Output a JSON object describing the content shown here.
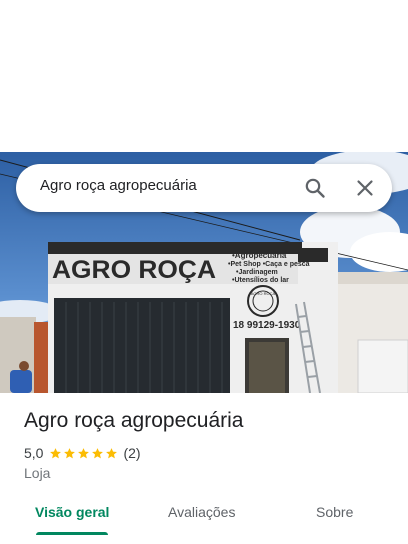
{
  "search": {
    "query": "Agro roça agropecuária"
  },
  "photo": {
    "sign_text": "AGRO ROÇA",
    "sign_services": [
      "•Agropecuária",
      "•Pet Shop •Caça e pesca",
      "•Jardinagem",
      "•Utensílios do lar"
    ],
    "phone": "18 99129-1930",
    "seal_text": "AGRO ROÇA"
  },
  "place": {
    "name": "Agro roça agropecuária",
    "rating": "5,0",
    "stars": 5,
    "reviews": "(2)",
    "category": "Loja"
  },
  "tabs": [
    {
      "label": "Visão geral",
      "active": true
    },
    {
      "label": "Avaliações",
      "active": false
    },
    {
      "label": "Sobre",
      "active": false
    }
  ],
  "colors": {
    "accent": "#01875f",
    "star": "#fbbc04",
    "text": "#202124"
  }
}
